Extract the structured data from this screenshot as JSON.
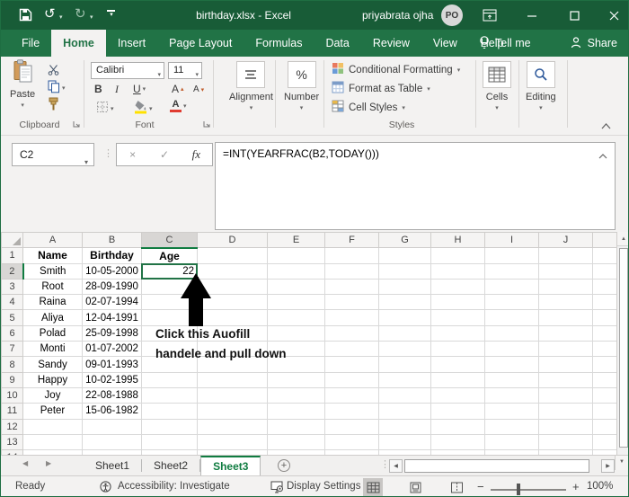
{
  "window": {
    "title": "birthday.xlsx - Excel",
    "user": "priyabrata ojha",
    "avatar": "PO"
  },
  "ribbon_tabs": {
    "items": [
      {
        "label": "File",
        "active": false
      },
      {
        "label": "Home",
        "active": true
      },
      {
        "label": "Insert",
        "active": false
      },
      {
        "label": "Page Layout",
        "active": false
      },
      {
        "label": "Formulas",
        "active": false
      },
      {
        "label": "Data",
        "active": false
      },
      {
        "label": "Review",
        "active": false
      },
      {
        "label": "View",
        "active": false
      },
      {
        "label": "Help",
        "active": false
      }
    ],
    "tell_me": "Tell me",
    "share": "Share"
  },
  "ribbon": {
    "clipboard": {
      "label": "Clipboard",
      "paste": "Paste"
    },
    "font": {
      "label": "Font",
      "family": "Calibri",
      "size": "11",
      "bold": "B",
      "italic": "I",
      "underline": "U"
    },
    "alignment": {
      "label": "Alignment"
    },
    "number": {
      "label": "Number",
      "percent": "%"
    },
    "styles": {
      "label": "Styles",
      "conditional": "Conditional Formatting",
      "format_table": "Format as Table",
      "cell_styles": "Cell Styles"
    },
    "cells": {
      "label": "Cells"
    },
    "editing": {
      "label": "Editing"
    }
  },
  "formula_bar": {
    "name_box": "C2",
    "fx": "fx",
    "formula": "=INT(YEARFRAC(B2,TODAY()))"
  },
  "grid": {
    "columns": [
      "A",
      "B",
      "C",
      "D",
      "E",
      "F",
      "G",
      "H",
      "I",
      "J"
    ],
    "row_count": 14,
    "selected": {
      "cell": "C2",
      "col": "C",
      "row": "2"
    },
    "cells": {
      "1": {
        "A": "Name",
        "B": "Birthday",
        "C": "Age"
      },
      "2": {
        "A": "Smith",
        "B": "10-05-2000",
        "C": "22"
      },
      "3": {
        "A": "Root",
        "B": "28-09-1990"
      },
      "4": {
        "A": "Raina",
        "B": "02-07-1994"
      },
      "5": {
        "A": "Aliya",
        "B": "12-04-1991"
      },
      "6": {
        "A": "Polad",
        "B": "25-09-1998"
      },
      "7": {
        "A": "Monti",
        "B": "01-07-2002"
      },
      "8": {
        "A": "Sandy",
        "B": "09-01-1993"
      },
      "9": {
        "A": "Happy",
        "B": "10-02-1995"
      },
      "10": {
        "A": "Joy",
        "B": "22-08-1988"
      },
      "11": {
        "A": "Peter",
        "B": "15-06-1982"
      }
    }
  },
  "annotation": {
    "line1": "Click this Auofill",
    "line2": "handele and pull down"
  },
  "sheet_tabs": {
    "items": [
      "Sheet1",
      "Sheet2",
      "Sheet3"
    ],
    "active": "Sheet3"
  },
  "status_bar": {
    "mode": "Ready",
    "accessibility": "Accessibility: Investigate",
    "display_settings": "Display Settings",
    "zoom_out": "−",
    "zoom_in": "+",
    "zoom": "100%"
  },
  "colors": {
    "title_green": "#185c37",
    "ribbon_green": "#217346",
    "accent_green": "#107c41",
    "fill_yellow": "#ffe100",
    "font_color_red": "#e03c31"
  }
}
